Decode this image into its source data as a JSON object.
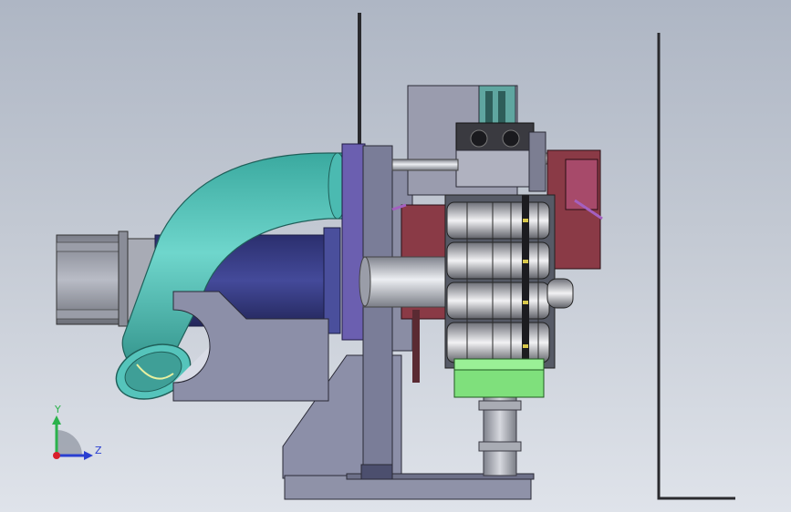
{
  "viewport": {
    "background_top": "#aeb6c4",
    "background_bottom": "#dfe3ea"
  },
  "triad": {
    "y_label": "Y",
    "z_label": "Z",
    "y_color": "#2bb24c",
    "z_color": "#2a3fd1",
    "origin_color": "#d81f2a"
  },
  "colors": {
    "tube": "#5fc8bf",
    "motor": "#3b3f86",
    "plate": "#8c8fa8",
    "bracket": "#7a6bb0",
    "rollers": "#d8d8d8",
    "maroon": "#8a3a46",
    "green_block": "#7fe07c",
    "shaft": "#b8bac2"
  }
}
